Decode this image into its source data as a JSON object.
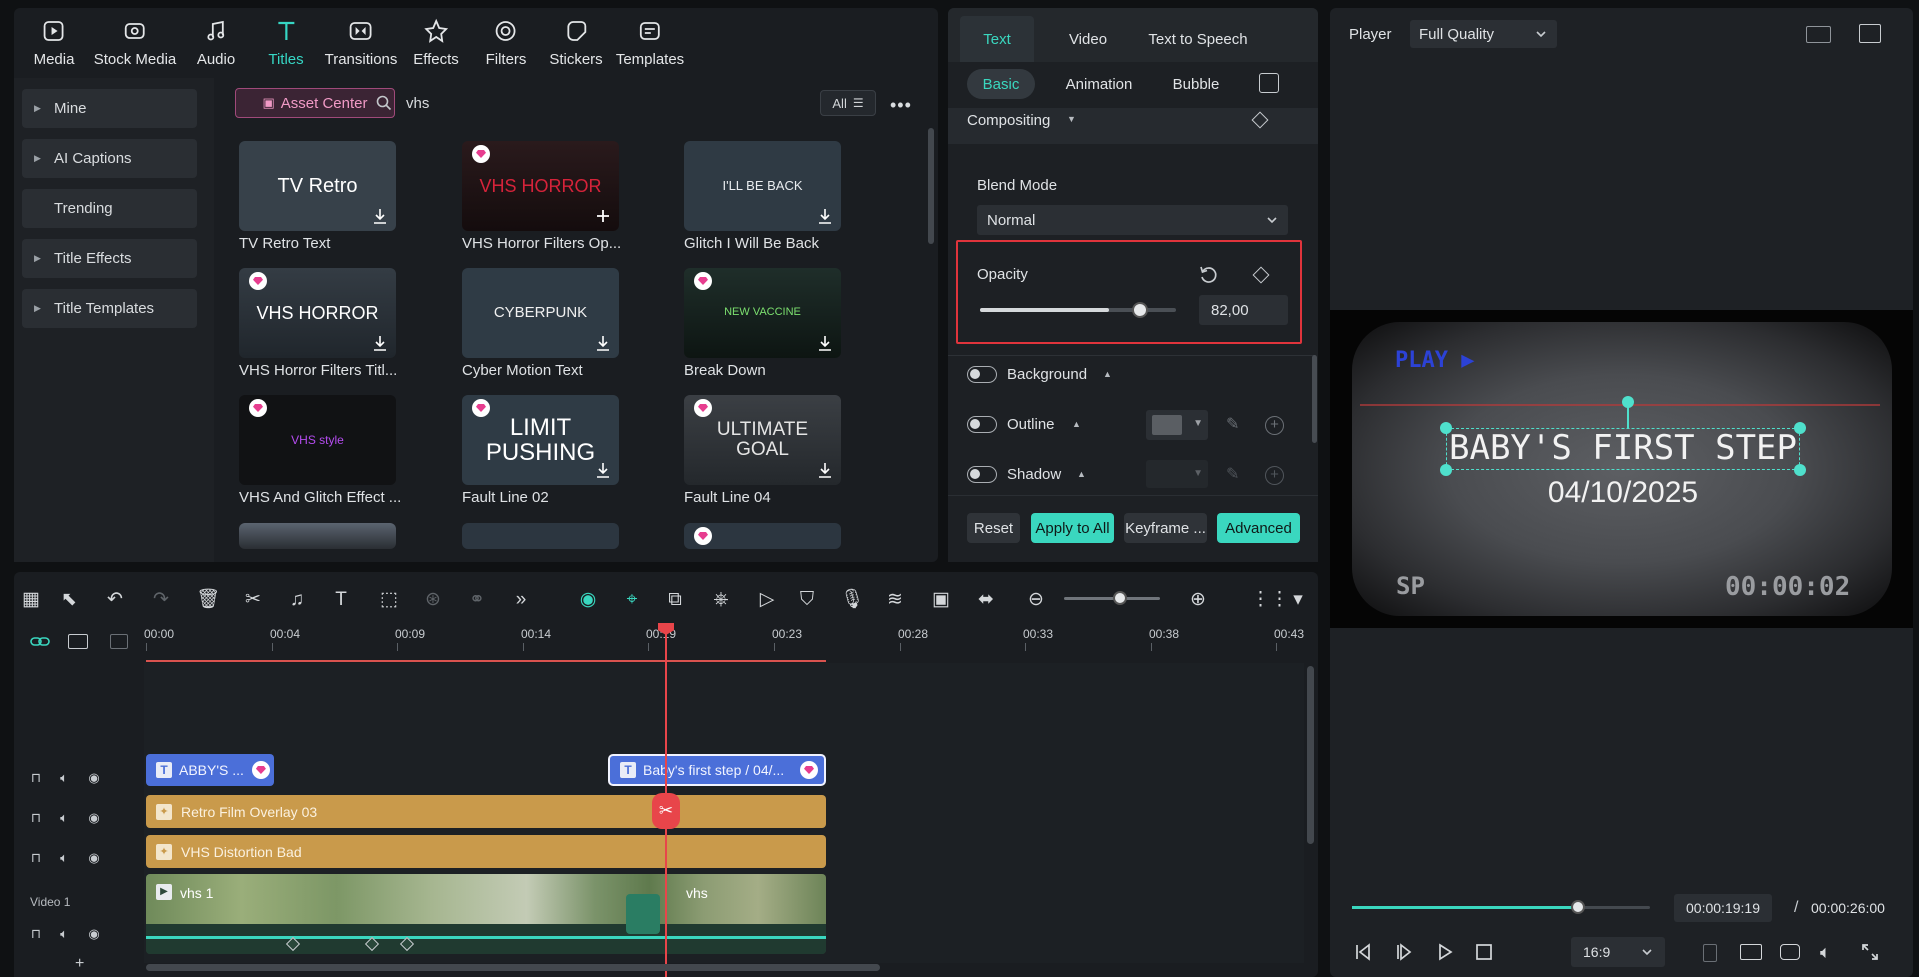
{
  "toolbar": {
    "items": [
      {
        "label": "Media",
        "icon": "media-icon"
      },
      {
        "label": "Stock Media",
        "icon": "stock-media-icon"
      },
      {
        "label": "Audio",
        "icon": "audio-icon"
      },
      {
        "label": "Titles",
        "icon": "titles-icon",
        "active": true
      },
      {
        "label": "Transitions",
        "icon": "transitions-icon"
      },
      {
        "label": "Effects",
        "icon": "effects-icon"
      },
      {
        "label": "Filters",
        "icon": "filters-icon"
      },
      {
        "label": "Stickers",
        "icon": "stickers-icon"
      },
      {
        "label": "Templates",
        "icon": "templates-icon"
      }
    ]
  },
  "sidebar": {
    "items": [
      {
        "label": "Mine",
        "expandable": true
      },
      {
        "label": "AI Captions",
        "expandable": true
      },
      {
        "label": "Trending",
        "expandable": false
      },
      {
        "label": "Title Effects",
        "expandable": true
      },
      {
        "label": "Title Templates",
        "expandable": true
      }
    ]
  },
  "library": {
    "asset_center_label": "Asset Center",
    "search_value": "vhs",
    "filter_label": "All",
    "items": [
      {
        "caption": "TV Retro Text",
        "thumb_text": "TV Retro",
        "premium": false,
        "action": "download"
      },
      {
        "caption": "VHS Horror Filters Op...",
        "thumb_text": "VHS HORROR",
        "premium": true,
        "action": "add"
      },
      {
        "caption": "Glitch I Will Be Back",
        "thumb_text": "I'LL BE BACK",
        "premium": false,
        "action": "download"
      },
      {
        "caption": "VHS Horror Filters Titl...",
        "thumb_text": "VHS HORROR",
        "premium": true,
        "action": "download"
      },
      {
        "caption": "Cyber Motion Text",
        "thumb_text": "CYBERPUNK",
        "premium": false,
        "action": "download"
      },
      {
        "caption": "Break Down",
        "thumb_text": "NEW VACCINE",
        "premium": true,
        "action": "download"
      },
      {
        "caption": "VHS And Glitch Effect ...",
        "thumb_text": "VHS style",
        "premium": true,
        "action": "none"
      },
      {
        "caption": "Fault Line 02",
        "thumb_text": "LIMIT PUSHING",
        "premium": true,
        "action": "download"
      },
      {
        "caption": "Fault Line 04",
        "thumb_text": "ULTIMATE GOAL",
        "premium": true,
        "action": "download"
      }
    ]
  },
  "props": {
    "tabs": [
      "Text",
      "Video",
      "Text to Speech"
    ],
    "active_tab": "Text",
    "subtabs": [
      "Basic",
      "Animation",
      "Bubble"
    ],
    "active_subtab": "Basic",
    "compositing_label": "Compositing",
    "blend_mode_label": "Blend Mode",
    "blend_mode_value": "Normal",
    "opacity_label": "Opacity",
    "opacity_value": "82,00",
    "opacity_fraction": 0.82,
    "background_label": "Background",
    "outline_label": "Outline",
    "shadow_label": "Shadow",
    "reset_label": "Reset",
    "apply_all_label": "Apply to All",
    "keyframe_label": "Keyframe ...",
    "advanced_label": "Advanced",
    "accent": "#3ad7bf",
    "highlight": "#e0343c"
  },
  "player": {
    "label": "Player",
    "quality": "Full Quality",
    "overlay_play": "PLAY ▶",
    "title_text": "BABY'S FIRST STEP",
    "date_text": "04/10/2025",
    "sp_text": "SP",
    "timer_text": "00:00:02",
    "current_time": "00:00:19:19",
    "separator": "/",
    "total_time": "00:00:26:00",
    "progress_fraction": 0.76,
    "aspect": "16:9"
  },
  "timeline": {
    "ticks": [
      "00:00",
      "00:04",
      "00:09",
      "00:14",
      "00:19",
      "00:23",
      "00:28",
      "00:33",
      "00:38",
      "00:43"
    ],
    "video_track_label": "Video 1",
    "clips": {
      "title1": "ABBY'S ...",
      "title2": "Baby's first step / 04/...",
      "overlay1": "Retro Film Overlay 03",
      "overlay2": "VHS Distortion Bad",
      "video_a": "vhs 1",
      "video_b": "vhs"
    },
    "add_track": "+"
  }
}
